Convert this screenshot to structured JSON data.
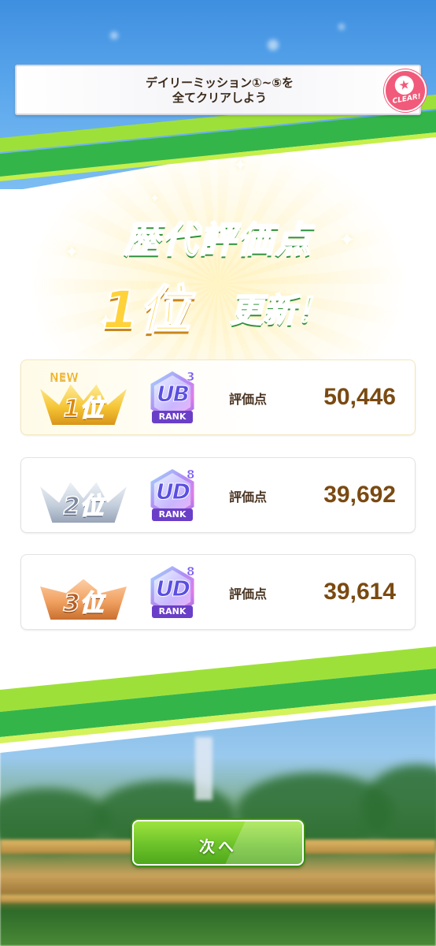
{
  "mission": {
    "text_line1": "デイリーミッション①~⑤を",
    "text_line2": "全てクリアしよう",
    "stamp_label": "CLEAR!",
    "stamp_icon": "star"
  },
  "headline": {
    "title": "歴代評価点",
    "rank": "1位",
    "updated": "更新！"
  },
  "rankings": [
    {
      "place": "1位",
      "is_new": true,
      "new_label": "NEW",
      "rank_letters": "UB",
      "rank_number": "3",
      "rank_word": "RANK",
      "score_label": "評価点",
      "score": "50,446",
      "medal": "gold"
    },
    {
      "place": "2位",
      "is_new": false,
      "new_label": "",
      "rank_letters": "UD",
      "rank_number": "8",
      "rank_word": "RANK",
      "score_label": "評価点",
      "score": "39,692",
      "medal": "silver"
    },
    {
      "place": "3位",
      "is_new": false,
      "new_label": "",
      "rank_letters": "UD",
      "rank_number": "8",
      "rank_word": "RANK",
      "score_label": "評価点",
      "score": "39,614",
      "medal": "bronze"
    }
  ],
  "next_button": {
    "label": "次へ"
  },
  "colors": {
    "accent_green": "#6cc22a",
    "score_brown": "#7a4a12",
    "stamp_pink": "#f15a7a",
    "gold": "#f5c534"
  }
}
